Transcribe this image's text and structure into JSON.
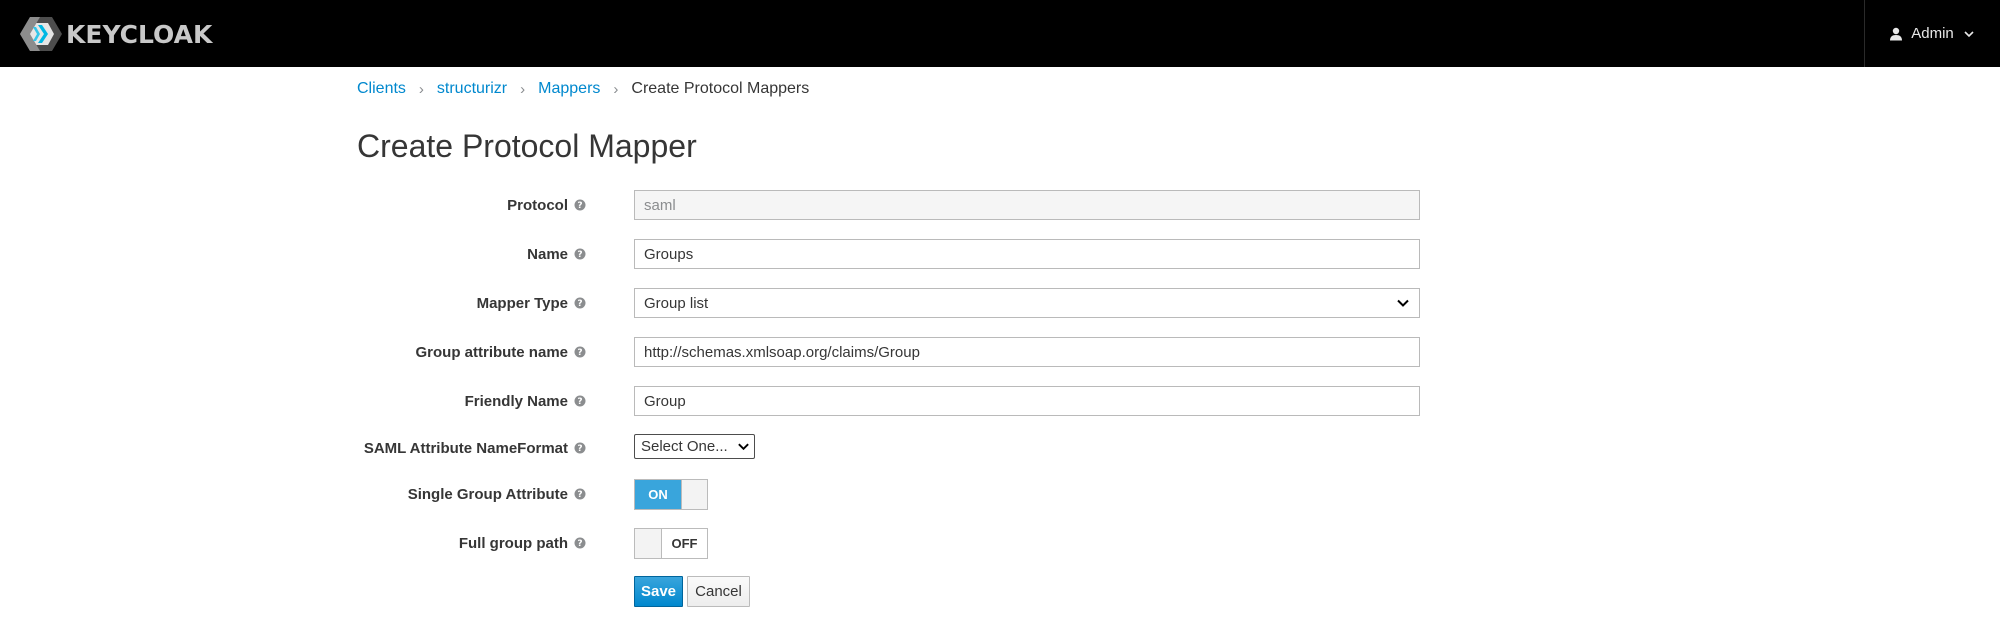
{
  "header": {
    "brand": "KEYCLOAK",
    "user_label": "Admin"
  },
  "breadcrumb": [
    {
      "label": "Clients",
      "link": true
    },
    {
      "label": "structurizr",
      "link": true
    },
    {
      "label": "Mappers",
      "link": true
    },
    {
      "label": "Create Protocol Mappers",
      "link": false
    }
  ],
  "page": {
    "title": "Create Protocol Mapper"
  },
  "form": {
    "protocol": {
      "label": "Protocol",
      "value": "saml"
    },
    "name": {
      "label": "Name",
      "value": "Groups"
    },
    "mapper_type": {
      "label": "Mapper Type",
      "value": "Group list"
    },
    "group_attribute_name": {
      "label": "Group attribute name",
      "value": "http://schemas.xmlsoap.org/claims/Group"
    },
    "friendly_name": {
      "label": "Friendly Name",
      "value": "Group"
    },
    "saml_nameformat": {
      "label": "SAML Attribute NameFormat",
      "value": "Select One..."
    },
    "single_group_attribute": {
      "label": "Single Group Attribute",
      "state": "ON"
    },
    "full_group_path": {
      "label": "Full group path",
      "state": "OFF"
    }
  },
  "actions": {
    "save_label": "Save",
    "cancel_label": "Cancel"
  },
  "colors": {
    "accent": "#0088ce",
    "toggle_on": "#39a5dc",
    "header_bg": "#000000"
  }
}
